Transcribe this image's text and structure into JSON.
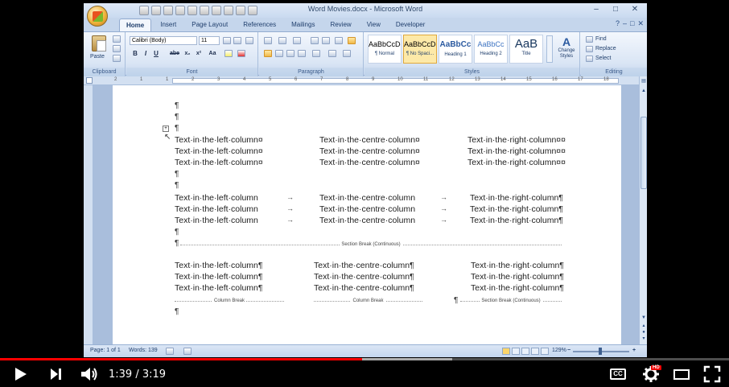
{
  "window": {
    "title": "Word Movies.docx - Microsoft Word",
    "minimize": "–",
    "restore": "□",
    "close": "✕"
  },
  "ribbon": {
    "tabs": [
      "Home",
      "Insert",
      "Page Layout",
      "References",
      "Mailings",
      "Review",
      "View",
      "Developer"
    ],
    "clipboard": {
      "paste_label": "Paste",
      "group_label": "Clipboard"
    },
    "font": {
      "font_name": "Calibri (Body)",
      "font_size": "11",
      "group_label": "Font",
      "format_buttons": [
        "B",
        "I",
        "U",
        "abe",
        "x₂",
        "x²",
        "Aa"
      ]
    },
    "paragraph": {
      "group_label": "Paragraph"
    },
    "styles": {
      "group_label": "Styles",
      "items": [
        {
          "sample": "AaBbCcDc",
          "name": "¶ Normal"
        },
        {
          "sample": "AaBbCcDc",
          "name": "¶ No Spaci..."
        },
        {
          "sample": "AaBbCc",
          "name": "Heading 1"
        },
        {
          "sample": "AaBbCc",
          "name": "Heading 2"
        },
        {
          "sample": "AaB",
          "name": "Title"
        }
      ],
      "change_styles": "Change Styles"
    },
    "editing": {
      "group_label": "Editing",
      "find": "Find",
      "replace": "Replace",
      "select": "Select"
    }
  },
  "ruler_marks": [
    "2",
    "1",
    "1",
    "2",
    "3",
    "4",
    "5",
    "6",
    "7",
    "8",
    "9",
    "10",
    "11",
    "12",
    "13",
    "14",
    "15",
    "16",
    "17",
    "18"
  ],
  "document": {
    "pilcrow": "¶",
    "table_rows": [
      [
        "Text·in·the·left·column¤",
        "Text·in·the·centre·column¤",
        "Text·in·the·right·column¤¤"
      ],
      [
        "Text·in·the·left·column¤",
        "Text·in·the·centre·column¤",
        "Text·in·the·right·column¤¤"
      ],
      [
        "Text·in·the·left·column¤",
        "Text·in·the·centre·column¤",
        "Text·in·the·right·column¤¤"
      ]
    ],
    "tab_rows": [
      [
        "Text·in·the·left·column",
        "Text·in·the·centre·column",
        "Text·in·the·right·column¶"
      ],
      [
        "Text·in·the·left·column",
        "Text·in·the·centre·column",
        "Text·in·the·right·column¶"
      ],
      [
        "Text·in·the·left·column",
        "Text·in·the·centre·column",
        "Text·in·the·right·column¶"
      ]
    ],
    "tab_arrow": "→",
    "section_break": "Section Break (Continuous)",
    "column_rows": [
      [
        "Text·in·the·left·column¶",
        "Text·in·the·centre·column¶",
        "Text·in·the·right·column¶"
      ],
      [
        "Text·in·the·left·column¶",
        "Text·in·the·centre·column¶",
        "Text·in·the·right·column¶"
      ],
      [
        "Text·in·the·left·column¶",
        "Text·in·the·centre·column¶",
        "Text·in·the·right·column¶"
      ]
    ],
    "column_break": "Column Break"
  },
  "status": {
    "page": "Page: 1 of 1",
    "words": "Words: 139",
    "zoom": "129%"
  },
  "player": {
    "time": "1:39 / 3:19",
    "progress_fraction": 0.497,
    "buffer_fraction": 0.62,
    "cc": "CC",
    "hd": "HD"
  }
}
